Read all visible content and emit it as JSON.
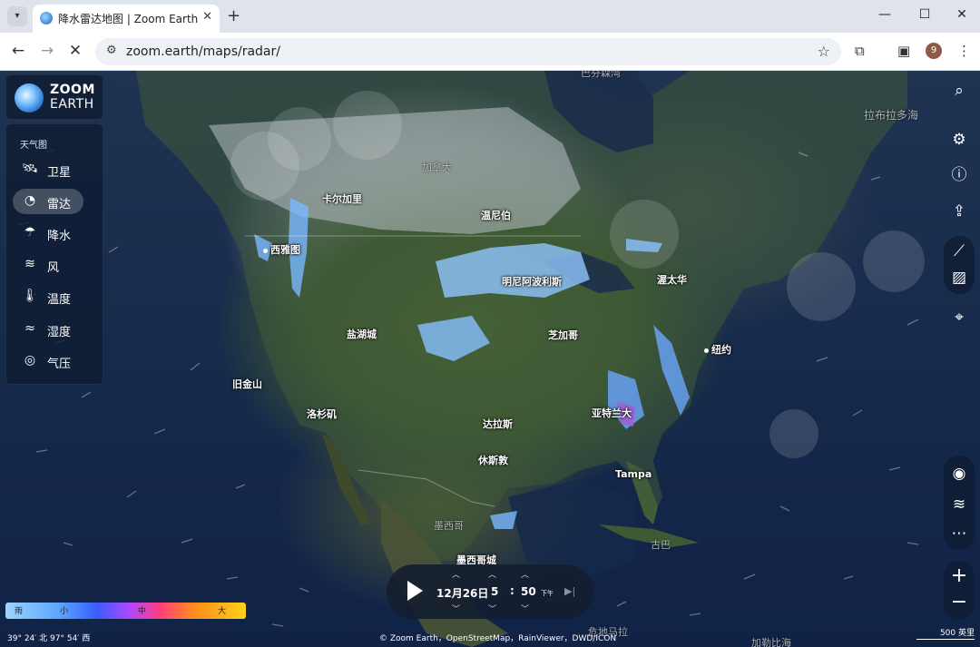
{
  "browser": {
    "tab_title": "降水雷达地图 | Zoom Earth",
    "url": "zoom.earth/maps/radar/",
    "profile_initial": "9",
    "icons": {
      "tab_menu": "▾",
      "close_tab": "✕",
      "new_tab": "+",
      "minimize": "—",
      "maximize": "☐",
      "close_window": "✕",
      "back": "←",
      "forward": "→",
      "stop": "✕",
      "site_info": "⚙",
      "bookmark": "☆",
      "extensions": "⧉",
      "side_panel": "▣",
      "menu": "⋮"
    }
  },
  "app": {
    "logo_line1": "ZOOM",
    "logo_line2": "EARTH",
    "layers_title": "天气图",
    "layers": [
      {
        "label": "卫星",
        "icon": "satellite-icon",
        "glyph": "🛰",
        "active": false
      },
      {
        "label": "雷达",
        "icon": "radar-icon",
        "glyph": "◔",
        "active": true
      },
      {
        "label": "降水",
        "icon": "rain-icon",
        "glyph": "☂",
        "active": false
      },
      {
        "label": "风",
        "icon": "wind-icon",
        "glyph": "≋",
        "active": false
      },
      {
        "label": "温度",
        "icon": "thermometer-icon",
        "glyph": "🌡",
        "active": false
      },
      {
        "label": "湿度",
        "icon": "humidity-icon",
        "glyph": "≈",
        "active": false
      },
      {
        "label": "气压",
        "icon": "gauge-icon",
        "glyph": "◎",
        "active": false
      }
    ],
    "right_controls": {
      "search": "⌕",
      "settings": "⚙",
      "info": "ⓘ",
      "share": "⇪",
      "measure": "⟋",
      "area": "▨",
      "locate": "⌖",
      "storm": "◉",
      "wind_particles": "≋",
      "more": "⋯",
      "zoom_in": "+",
      "zoom_out": "−"
    }
  },
  "map": {
    "cities": {
      "calgary": "卡尔加里",
      "seattle": "西雅图",
      "winnipeg": "温尼伯",
      "minneapolis": "明尼阿波利斯",
      "ottawa": "渥太华",
      "salt_lake": "盐湖城",
      "chicago": "芝加哥",
      "newyork": "纽约",
      "sanfrancisco": "旧金山",
      "losangeles": "洛杉矶",
      "dallas": "达拉斯",
      "atlanta": "亚特兰大",
      "houston": "休斯敦",
      "tampa": "Tampa",
      "mexicocity": "墨西哥城"
    },
    "regions": {
      "canada": "加拿大",
      "labrador": "拉布拉多海",
      "mexico": "墨西哥",
      "cuba": "古巴",
      "baffin": "巴芬森湾",
      "guatemala": "危地马拉",
      "caribbean": "加勒比海"
    }
  },
  "timebar": {
    "date": "12月26日",
    "hour": "5",
    "colon": ":",
    "minute": "50",
    "ampm": "下午",
    "skip": "▶|",
    "up": "︿",
    "down": "﹀"
  },
  "legend": {
    "labels": [
      "雨",
      "小",
      "中",
      "大"
    ]
  },
  "coordinates": "39° 24′ 北 97° 54′ 西",
  "attribution": "© Zoom Earth，OpenStreetMap，RainViewer，DWD/ICON",
  "scale": "500 英里"
}
